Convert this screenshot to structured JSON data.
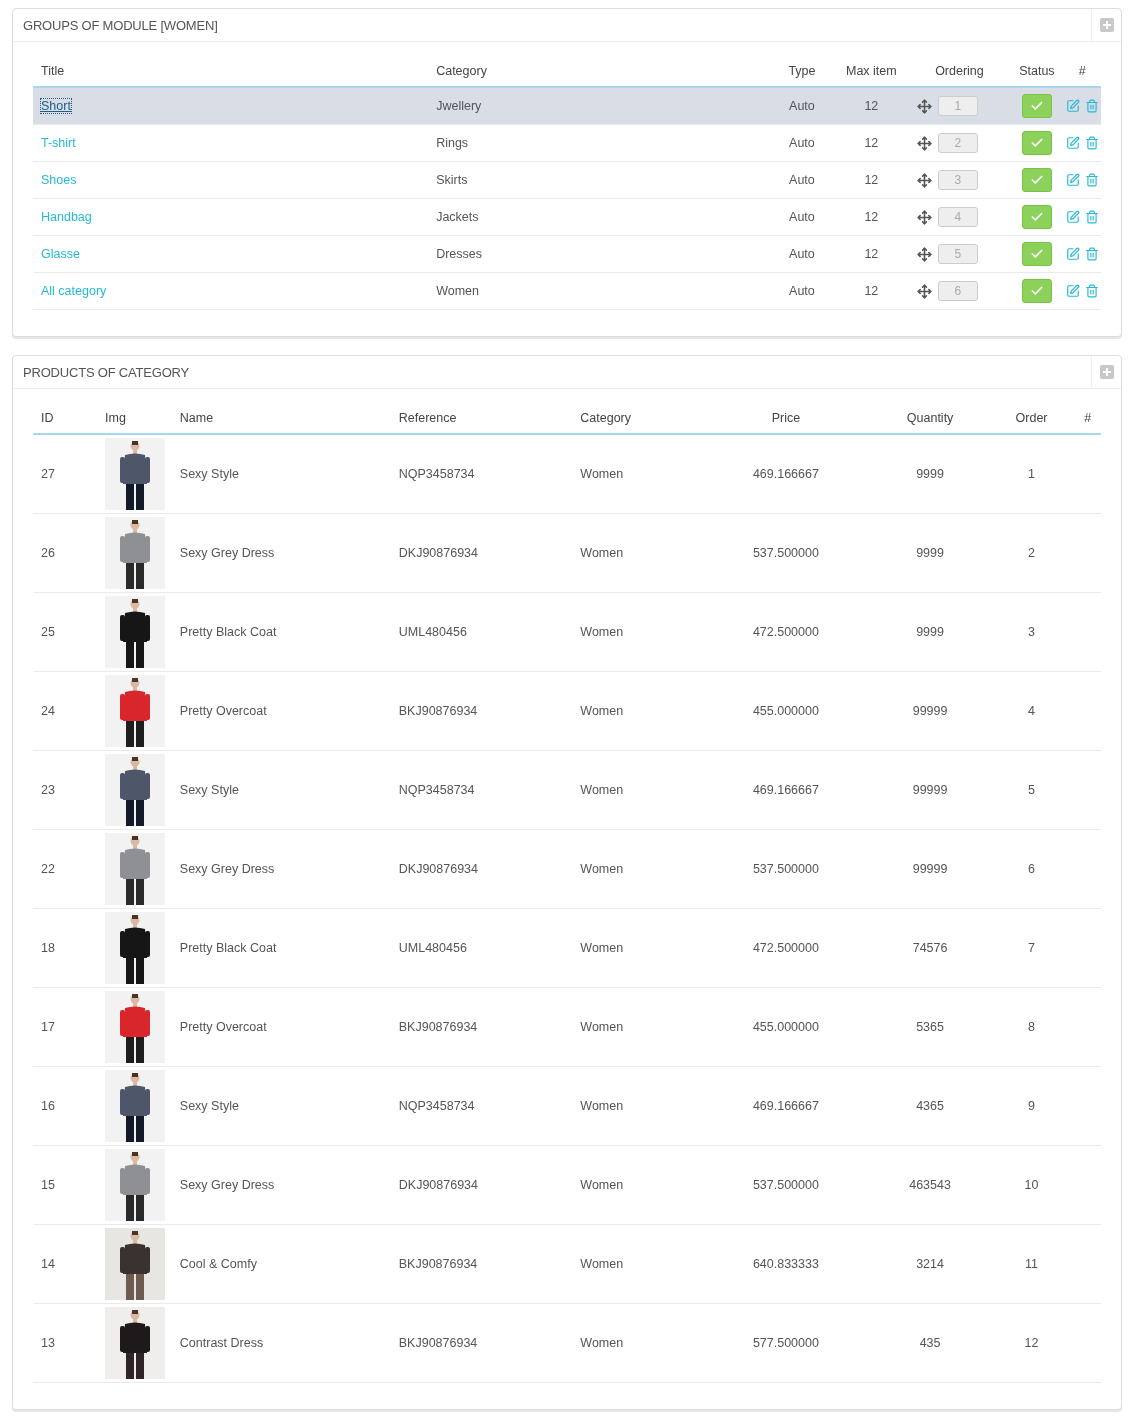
{
  "groups_panel": {
    "title": "GROUPS OF MODULE [WOMEN]",
    "columns": [
      "Title",
      "Category",
      "Type",
      "Max item",
      "Ordering",
      "Status",
      "#"
    ],
    "rows": [
      {
        "title": "Short",
        "category": "Jwellery",
        "type": "Auto",
        "max_item": "12",
        "ordering": "1",
        "on": true,
        "selected": true
      },
      {
        "title": "T-shirt",
        "category": "Rings",
        "type": "Auto",
        "max_item": "12",
        "ordering": "2",
        "on": true,
        "selected": false
      },
      {
        "title": "Shoes",
        "category": "Skirts",
        "type": "Auto",
        "max_item": "12",
        "ordering": "3",
        "on": true,
        "selected": false
      },
      {
        "title": "Handbag",
        "category": "Jackets",
        "type": "Auto",
        "max_item": "12",
        "ordering": "4",
        "on": true,
        "selected": false
      },
      {
        "title": "Glasse",
        "category": "Dresses",
        "type": "Auto",
        "max_item": "12",
        "ordering": "5",
        "on": true,
        "selected": false
      },
      {
        "title": "All category",
        "category": "Women",
        "type": "Auto",
        "max_item": "12",
        "ordering": "6",
        "on": true,
        "selected": false
      }
    ]
  },
  "products_panel": {
    "title": "PRODUCTS OF CATEGORY",
    "columns": [
      "ID",
      "Img",
      "Name",
      "Reference",
      "Category",
      "Price",
      "Quantity",
      "Order",
      "#"
    ],
    "rows": [
      {
        "id": "27",
        "name": "Sexy Style",
        "reference": "NQP3458734",
        "category": "Women",
        "price": "469.166667",
        "quantity": "9999",
        "order": "1"
      },
      {
        "id": "26",
        "name": "Sexy Grey Dress",
        "reference": "DKJ90876934",
        "category": "Women",
        "price": "537.500000",
        "quantity": "9999",
        "order": "2"
      },
      {
        "id": "25",
        "name": "Pretty Black Coat",
        "reference": "UML480456",
        "category": "Women",
        "price": "472.500000",
        "quantity": "9999",
        "order": "3"
      },
      {
        "id": "24",
        "name": "Pretty Overcoat",
        "reference": "BKJ90876934",
        "category": "Women",
        "price": "455.000000",
        "quantity": "99999",
        "order": "4"
      },
      {
        "id": "23",
        "name": "Sexy Style",
        "reference": "NQP3458734",
        "category": "Women",
        "price": "469.166667",
        "quantity": "99999",
        "order": "5"
      },
      {
        "id": "22",
        "name": "Sexy Grey Dress",
        "reference": "DKJ90876934",
        "category": "Women",
        "price": "537.500000",
        "quantity": "99999",
        "order": "6"
      },
      {
        "id": "18",
        "name": "Pretty Black Coat",
        "reference": "UML480456",
        "category": "Women",
        "price": "472.500000",
        "quantity": "74576",
        "order": "7"
      },
      {
        "id": "17",
        "name": "Pretty Overcoat",
        "reference": "BKJ90876934",
        "category": "Women",
        "price": "455.000000",
        "quantity": "5365",
        "order": "8"
      },
      {
        "id": "16",
        "name": "Sexy Style",
        "reference": "NQP3458734",
        "category": "Women",
        "price": "469.166667",
        "quantity": "4365",
        "order": "9"
      },
      {
        "id": "15",
        "name": "Sexy Grey Dress",
        "reference": "DKJ90876934",
        "category": "Women",
        "price": "537.500000",
        "quantity": "463543",
        "order": "10"
      },
      {
        "id": "14",
        "name": "Cool & Comfy",
        "reference": "BKJ90876934",
        "category": "Women",
        "price": "640.833333",
        "quantity": "3214",
        "order": "11"
      },
      {
        "id": "13",
        "name": "Contrast Dress",
        "reference": "BKJ90876934",
        "category": "Women",
        "price": "577.500000",
        "quantity": "435",
        "order": "12"
      }
    ]
  }
}
